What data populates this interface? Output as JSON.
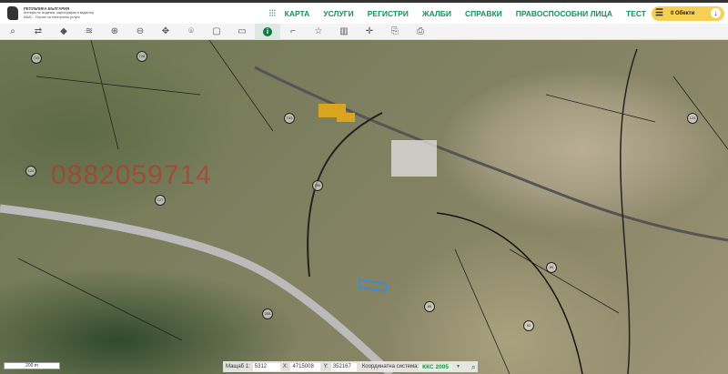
{
  "header": {
    "logo_title": "РЕПУБЛИКА БЪЛГАРИЯ",
    "logo_line1": "Агенция по геодезия, картография и кадастър",
    "logo_line2": "КАИС - Портал за електронни услуги"
  },
  "nav": {
    "items": [
      "КАРТА",
      "УСЛУГИ",
      "РЕГИСТРИ",
      "ЖАЛБИ",
      "СПРАВКИ",
      "ПРАВОСПОСОБНИ ЛИЦА",
      "ТЕСТ"
    ],
    "objects_label": "0 Обекти"
  },
  "toolbar": {
    "tools": [
      {
        "name": "search-icon",
        "glyph": "⌕"
      },
      {
        "name": "route-icon",
        "glyph": "⇄"
      },
      {
        "name": "layer-icon",
        "glyph": "◆"
      },
      {
        "name": "layers-icon",
        "glyph": "≋"
      },
      {
        "name": "zoom-in-icon",
        "glyph": "⊕"
      },
      {
        "name": "zoom-out-icon",
        "glyph": "⊖"
      },
      {
        "name": "pan-icon",
        "glyph": "✥"
      },
      {
        "name": "location-pin-icon",
        "glyph": "⌾"
      },
      {
        "name": "select-rect-icon",
        "glyph": "▢"
      },
      {
        "name": "deselect-rect-icon",
        "glyph": "▭"
      },
      {
        "name": "info-icon",
        "glyph": "i"
      },
      {
        "name": "measure-icon",
        "glyph": "⌐"
      },
      {
        "name": "polygon-icon",
        "glyph": "☆"
      },
      {
        "name": "map-icon",
        "glyph": "▥"
      },
      {
        "name": "crosshair-icon",
        "glyph": "✛"
      },
      {
        "name": "export-icon",
        "glyph": "⎘"
      },
      {
        "name": "print-icon",
        "glyph": "⎙"
      }
    ]
  },
  "map": {
    "watermark": "0882059714",
    "parcels": [
      "725",
      "728",
      "124",
      "127",
      "733",
      "256",
      "89",
      "92",
      "85",
      "255",
      "124"
    ]
  },
  "scale_bar": "200 m",
  "status": {
    "scale_label": "Мащаб 1:",
    "scale_value": "5312",
    "x_label": "X:",
    "x_value": "4715008",
    "y_label": "Y:",
    "y_value": "352167",
    "crs_label": "Координатна система:",
    "crs_value": "ККС 2005"
  }
}
